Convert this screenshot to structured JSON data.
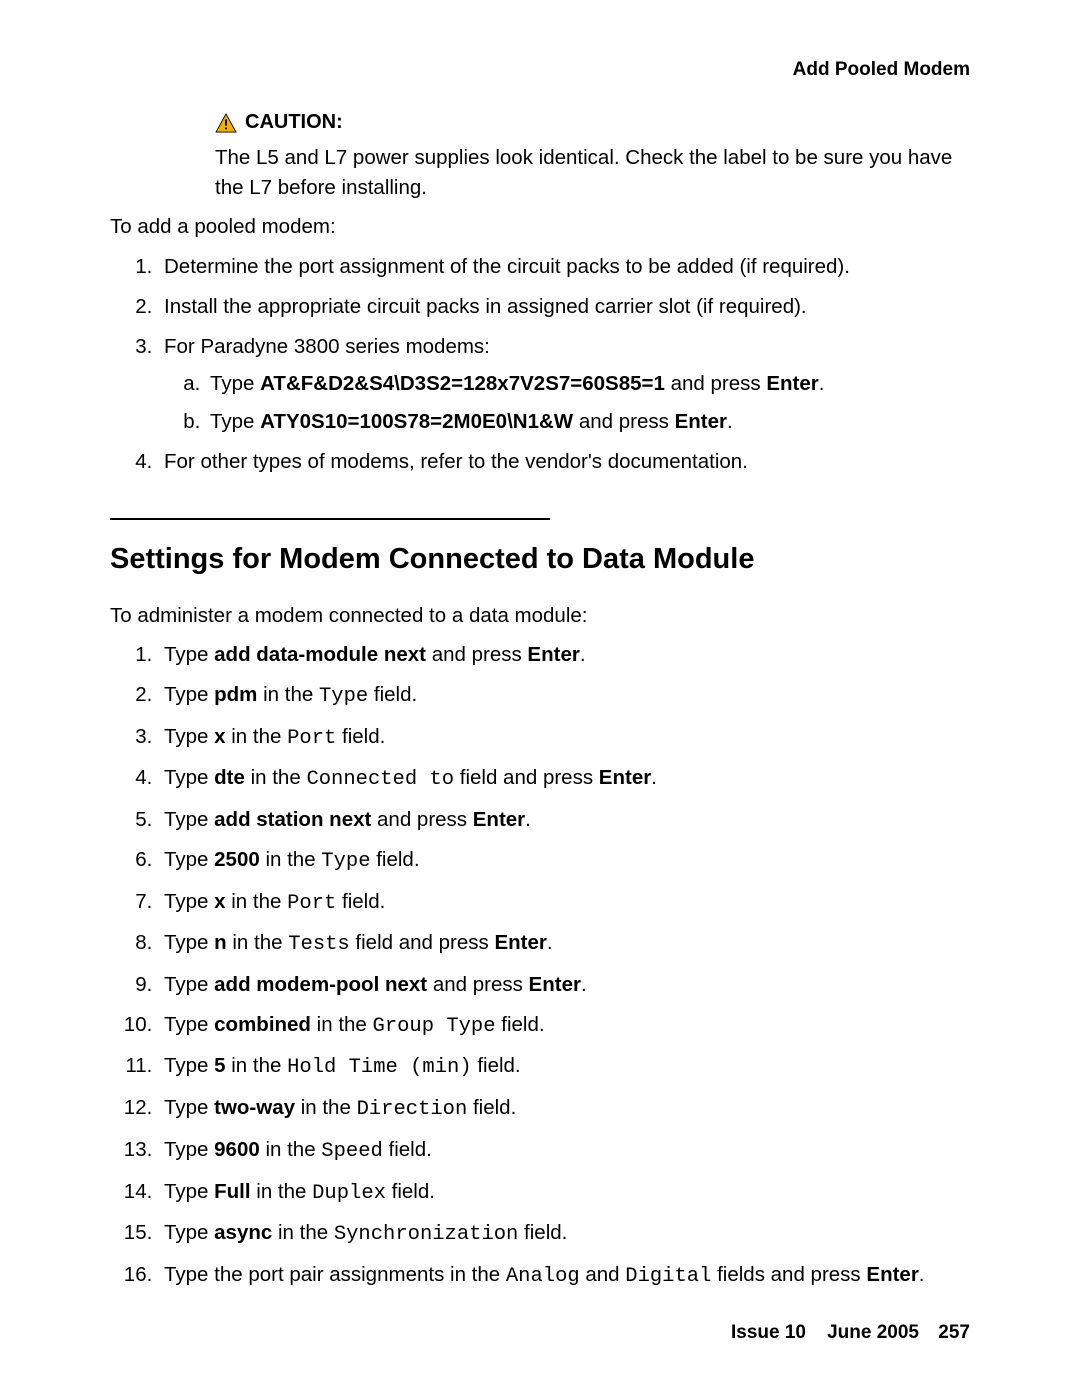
{
  "header": {
    "right": "Add Pooled Modem"
  },
  "caution": {
    "label": "CAUTION:",
    "text": "The L5 and L7 power supplies look identical. Check the label to be sure you have the L7 before installing."
  },
  "intro1": "To add a pooled modem:",
  "list1": {
    "i1": "Determine the port assignment of the circuit packs to be added (if required).",
    "i2": "Install the appropriate circuit packs in assigned carrier slot (if required).",
    "i3": "For Paradyne 3800 series modems:",
    "i3a_pre": "Type ",
    "i3a_cmd": "AT&F&D2&S4\\D3S2=128x7V2S7=60S85=1",
    "i3a_mid": " and press ",
    "i3a_key": "Enter",
    "i3a_suf": ".",
    "i3b_pre": "Type ",
    "i3b_cmd": "ATY0S10=100S78=2M0E0\\N1&W",
    "i3b_mid": " and press ",
    "i3b_key": "Enter",
    "i3b_suf": ".",
    "i4": "For other types of modems, refer to the vendor's documentation."
  },
  "section": "Settings for Modem Connected to Data Module",
  "intro2": "To administer a modem connected to a data module:",
  "list2": {
    "s1_pre": "Type ",
    "s1_b": "add data-module next",
    "s1_mid": " and press ",
    "s1_k": "Enter",
    "s1_suf": ".",
    "s2_pre": "Type ",
    "s2_b": "pdm",
    "s2_mid": " in the ",
    "s2_m": "Type",
    "s2_suf": " field.",
    "s3_pre": "Type ",
    "s3_b": "x",
    "s3_mid": " in the ",
    "s3_m": "Port",
    "s3_suf": " field.",
    "s4_pre": "Type ",
    "s4_b": "dte",
    "s4_mid": " in the ",
    "s4_m": "Connected to",
    "s4_mid2": " field and press ",
    "s4_k": "Enter",
    "s4_suf": ".",
    "s5_pre": "Type ",
    "s5_b": "add station next",
    "s5_mid": " and press ",
    "s5_k": "Enter",
    "s5_suf": ".",
    "s6_pre": "Type ",
    "s6_b": "2500",
    "s6_mid": " in the ",
    "s6_m": "Type",
    "s6_suf": " field.",
    "s7_pre": "Type ",
    "s7_b": "x",
    "s7_mid": " in the ",
    "s7_m": "Port",
    "s7_suf": " field.",
    "s8_pre": "Type ",
    "s8_b": "n",
    "s8_mid": " in the ",
    "s8_m": "Tests",
    "s8_mid2": " field and press ",
    "s8_k": "Enter",
    "s8_suf": ".",
    "s9_pre": "Type ",
    "s9_b": "add modem-pool next",
    "s9_mid": " and press ",
    "s9_k": "Enter",
    "s9_suf": ".",
    "s10_pre": "Type ",
    "s10_b": "combined",
    "s10_mid": " in the ",
    "s10_m": "Group Type",
    "s10_suf": " field.",
    "s11_pre": "Type ",
    "s11_b": "5",
    "s11_mid": " in the ",
    "s11_m": "Hold Time (min)",
    "s11_suf": " field.",
    "s12_pre": "Type ",
    "s12_b": "two-way",
    "s12_mid": " in the ",
    "s12_m": "Direction",
    "s12_suf": " field.",
    "s13_pre": "Type ",
    "s13_b": "9600",
    "s13_mid": " in the ",
    "s13_m": "Speed",
    "s13_suf": " field.",
    "s14_pre": "Type ",
    "s14_b": "Full",
    "s14_mid": " in the ",
    "s14_m": "Duplex",
    "s14_suf": " field.",
    "s15_pre": "Type ",
    "s15_b": "async",
    "s15_mid": " in the ",
    "s15_m": "Synchronization",
    "s15_suf": " field.",
    "s16_pre": "Type the port pair assignments in the ",
    "s16_m1": "Analog",
    "s16_mid": " and ",
    "s16_m2": "Digital",
    "s16_mid2": " fields and press ",
    "s16_k": "Enter",
    "s16_suf": "."
  },
  "footer": {
    "issue": "Issue 10",
    "date": "June 2005",
    "page": "257"
  }
}
